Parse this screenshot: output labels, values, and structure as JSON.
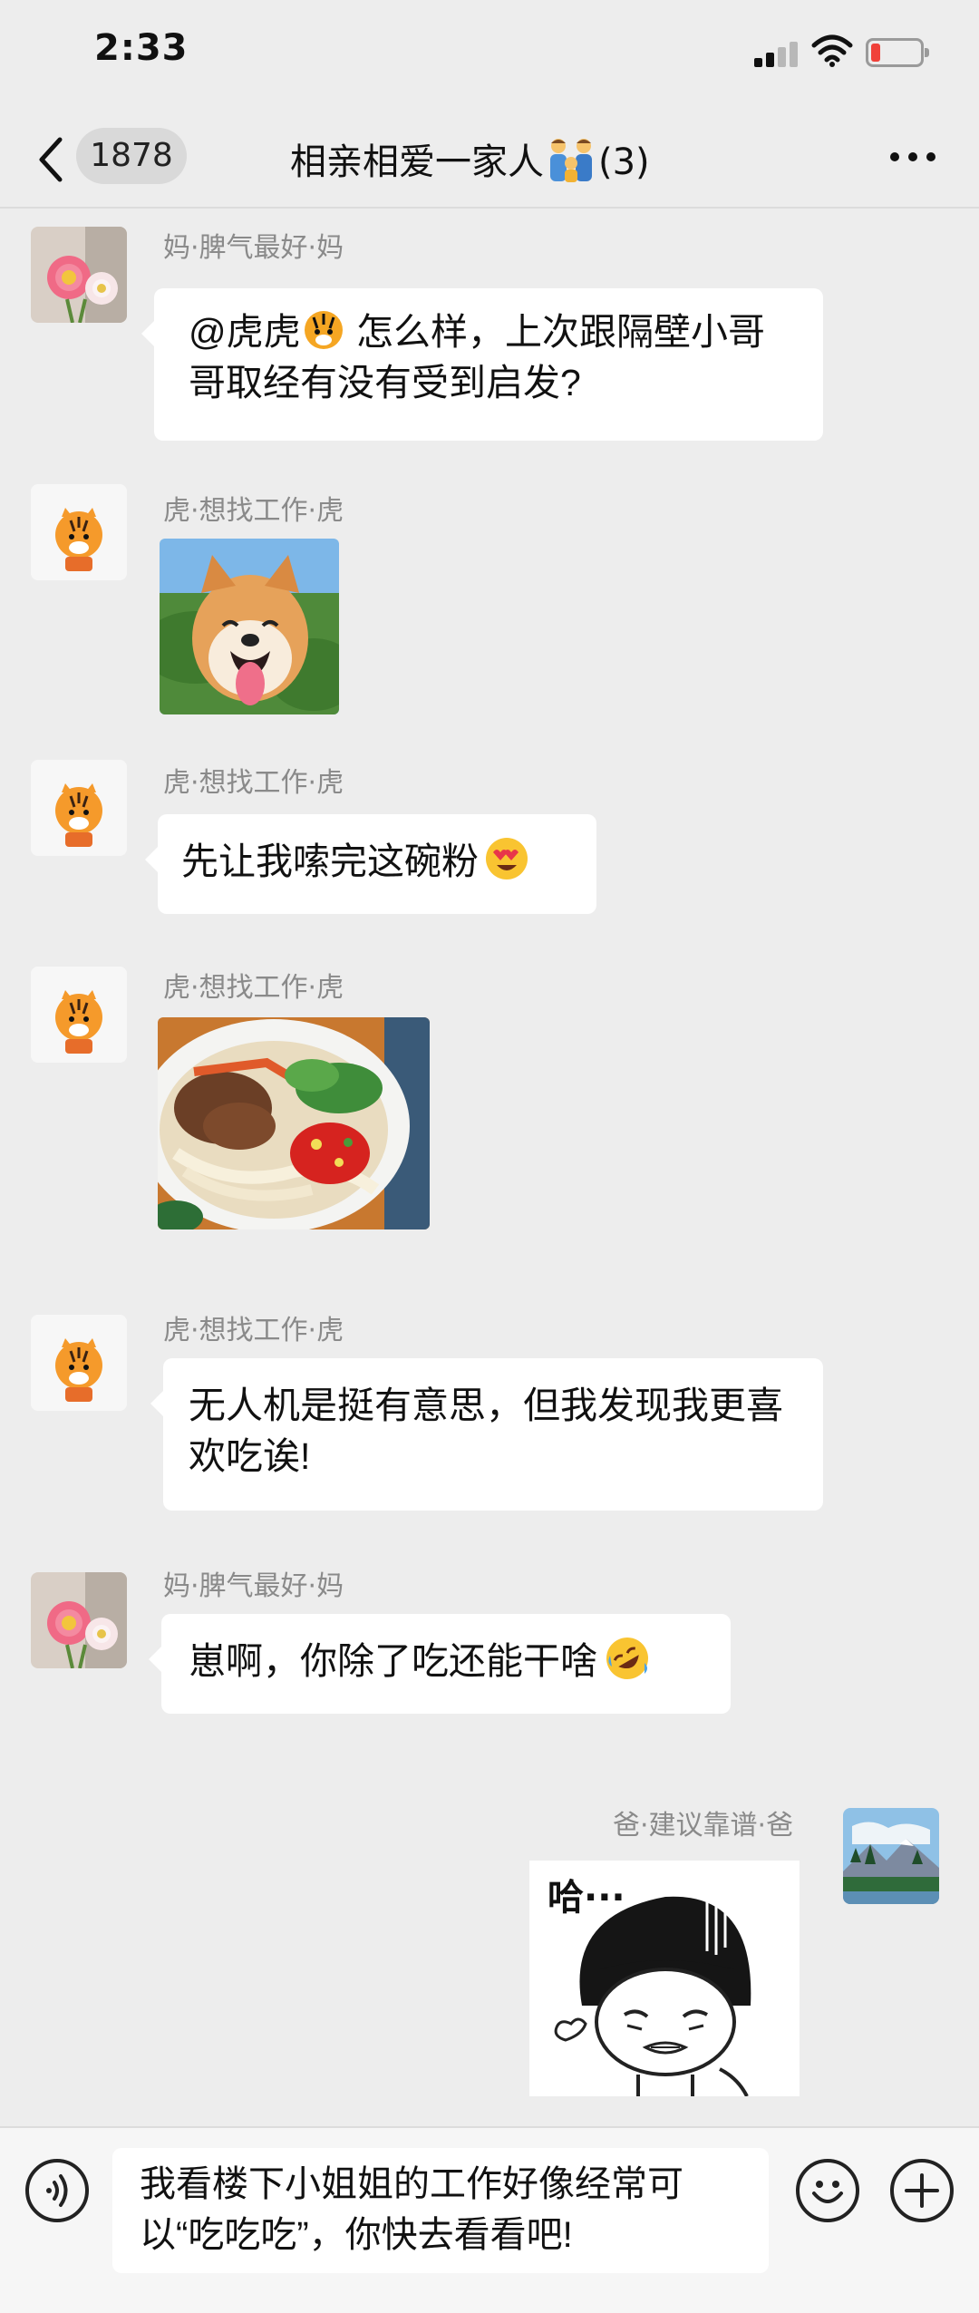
{
  "status_bar": {
    "time": "2:33"
  },
  "nav": {
    "back_label": "<",
    "unread_count": "1878",
    "title": "相亲相爱一家人",
    "member_count": "(3)",
    "more_label": "···"
  },
  "messages": [
    {
      "sender": "妈·脾气最好·妈",
      "text_before": "@虎虎",
      "text_after": " 怎么样，上次跟隔壁小哥哥取经有没有受到启发?"
    },
    {
      "sender": "虎·想找工作·虎"
    },
    {
      "sender": "虎·想找工作·虎",
      "text": "先让我嗦完这碗粉"
    },
    {
      "sender": "虎·想找工作·虎"
    },
    {
      "sender": "虎·想找工作·虎",
      "text": "无人机是挺有意思，但我发现我更喜欢吃诶!"
    },
    {
      "sender": "妈·脾气最好·妈",
      "text": "崽啊，你除了吃还能干啥"
    },
    {
      "sender": "爸·建议靠谱·爸",
      "sticker_text": "哈···"
    }
  ],
  "input": {
    "value": "我看楼下小姐姐的工作好像经常可以“吃吃吃”，你快去看看吧!"
  },
  "colors": {
    "background": "#ededed",
    "bubble": "#ffffff",
    "battery_low": "#f0413a"
  },
  "icons": [
    "back-icon",
    "more-icon",
    "signal-icon",
    "wifi-icon",
    "battery-icon",
    "voice-icon",
    "emoji-icon",
    "plus-icon"
  ]
}
